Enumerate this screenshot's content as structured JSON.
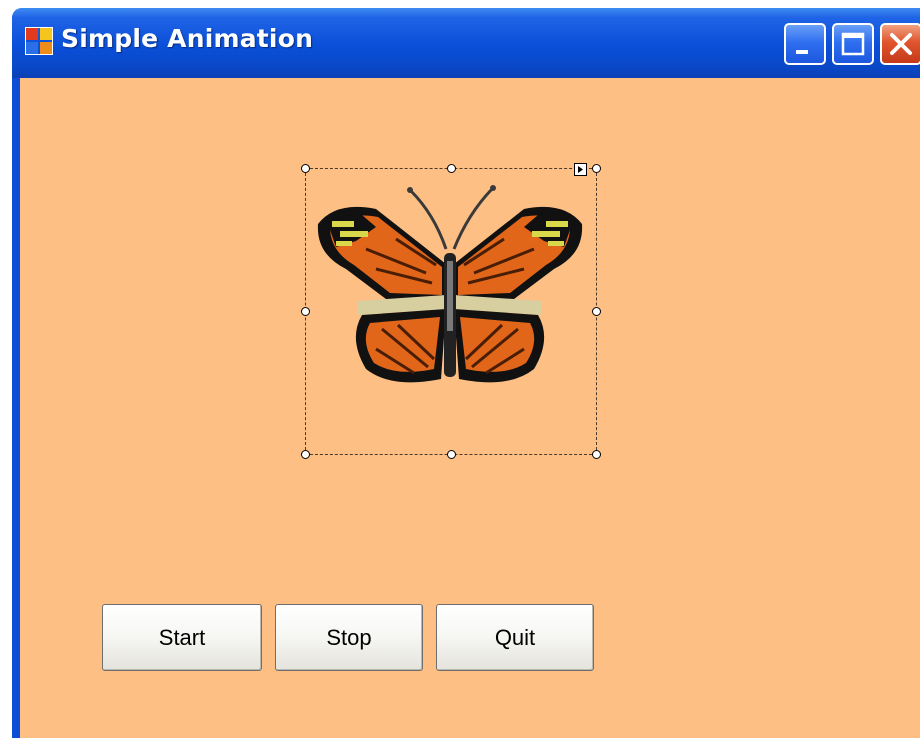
{
  "window": {
    "title": "Simple Animation",
    "icon": "app-window-icon",
    "controls": {
      "minimize": "minimize-icon",
      "maximize": "maximize-icon",
      "close": "close-icon"
    }
  },
  "form": {
    "background_color": "#fdbf84",
    "picture": {
      "icon": "butterfly-image",
      "selected": true
    },
    "buttons": {
      "start": "Start",
      "stop": "Stop",
      "quit": "Quit"
    }
  }
}
